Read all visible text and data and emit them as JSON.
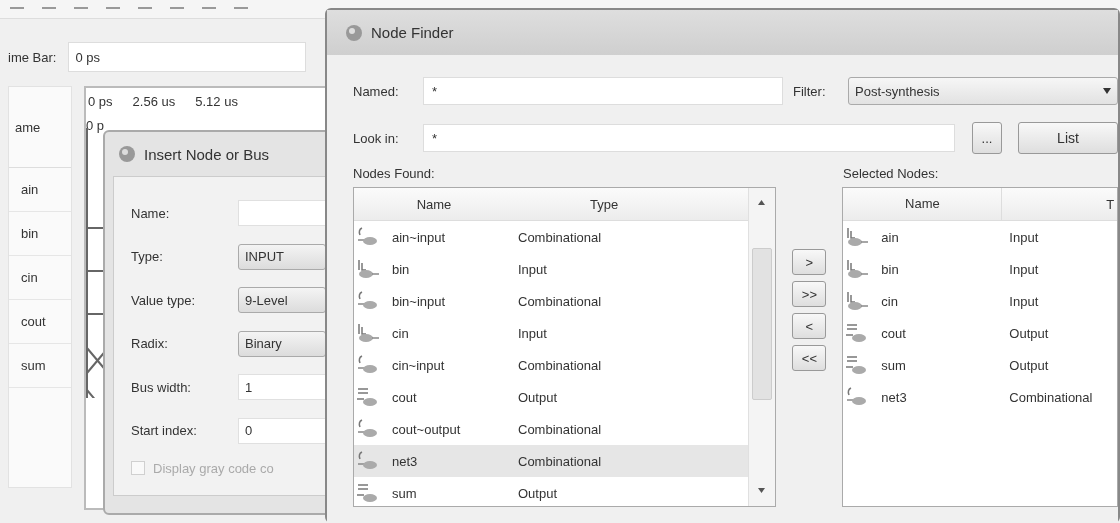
{
  "waveform_editor": {
    "time_bar_label": "ime Bar:",
    "time_bar_value": "0 ps",
    "name_header": "ame",
    "signals": [
      "ain",
      "bin",
      "cin",
      "cout",
      "sum"
    ],
    "time_ticks": [
      "0 ps",
      "2.56 us",
      "5.12 us"
    ],
    "cursor_label": "0 p"
  },
  "insert_dialog": {
    "title": "Insert Node or Bus",
    "fields": [
      {
        "label": "Name:",
        "kind": "text"
      },
      {
        "label": "Type:",
        "kind": "dropdown",
        "value": "INPUT"
      },
      {
        "label": "Value type:",
        "kind": "dropdown",
        "value": "9-Level"
      },
      {
        "label": "Radix:",
        "kind": "dropdown",
        "value": "Binary"
      },
      {
        "label": "Bus width:",
        "kind": "spin",
        "value": "1"
      },
      {
        "label": "Start index:",
        "kind": "spin",
        "value": "0"
      }
    ],
    "gray_code": {
      "label": "Display gray code co",
      "checked": false,
      "disabled": true
    }
  },
  "node_finder": {
    "title": "Node Finder",
    "named": {
      "label": "Named:",
      "value": "*"
    },
    "filter": {
      "label": "Filter:",
      "value": "Post-synthesis"
    },
    "look_in": {
      "label": "Look in:",
      "value": "*"
    },
    "browse_button": "...",
    "list_button": "List",
    "nodes_found": {
      "label": "Nodes Found:",
      "columns": [
        "Name",
        "Type"
      ],
      "rows": [
        {
          "name": "ain~input",
          "type": "Combinational",
          "kind": "combinational",
          "selected": false
        },
        {
          "name": "bin",
          "type": "Input",
          "kind": "input",
          "selected": false
        },
        {
          "name": "bin~input",
          "type": "Combinational",
          "kind": "combinational",
          "selected": false
        },
        {
          "name": "cin",
          "type": "Input",
          "kind": "input",
          "selected": false
        },
        {
          "name": "cin~input",
          "type": "Combinational",
          "kind": "combinational",
          "selected": false
        },
        {
          "name": "cout",
          "type": "Output",
          "kind": "output",
          "selected": false
        },
        {
          "name": "cout~output",
          "type": "Combinational",
          "kind": "combinational",
          "selected": false
        },
        {
          "name": "net3",
          "type": "Combinational",
          "kind": "combinational",
          "selected": true
        },
        {
          "name": "sum",
          "type": "Output",
          "kind": "output",
          "selected": false
        }
      ]
    },
    "move_buttons": [
      ">",
      ">>",
      "<",
      "<<"
    ],
    "selected_nodes": {
      "label": "Selected Nodes:",
      "columns": [
        "Name",
        "T"
      ],
      "rows": [
        {
          "name": "ain",
          "type": "Input",
          "kind": "input"
        },
        {
          "name": "bin",
          "type": "Input",
          "kind": "input"
        },
        {
          "name": "cin",
          "type": "Input",
          "kind": "input"
        },
        {
          "name": "cout",
          "type": "Output",
          "kind": "output"
        },
        {
          "name": "sum",
          "type": "Output",
          "kind": "output"
        },
        {
          "name": "net3",
          "type": "Combinational",
          "kind": "combinational"
        }
      ]
    }
  }
}
